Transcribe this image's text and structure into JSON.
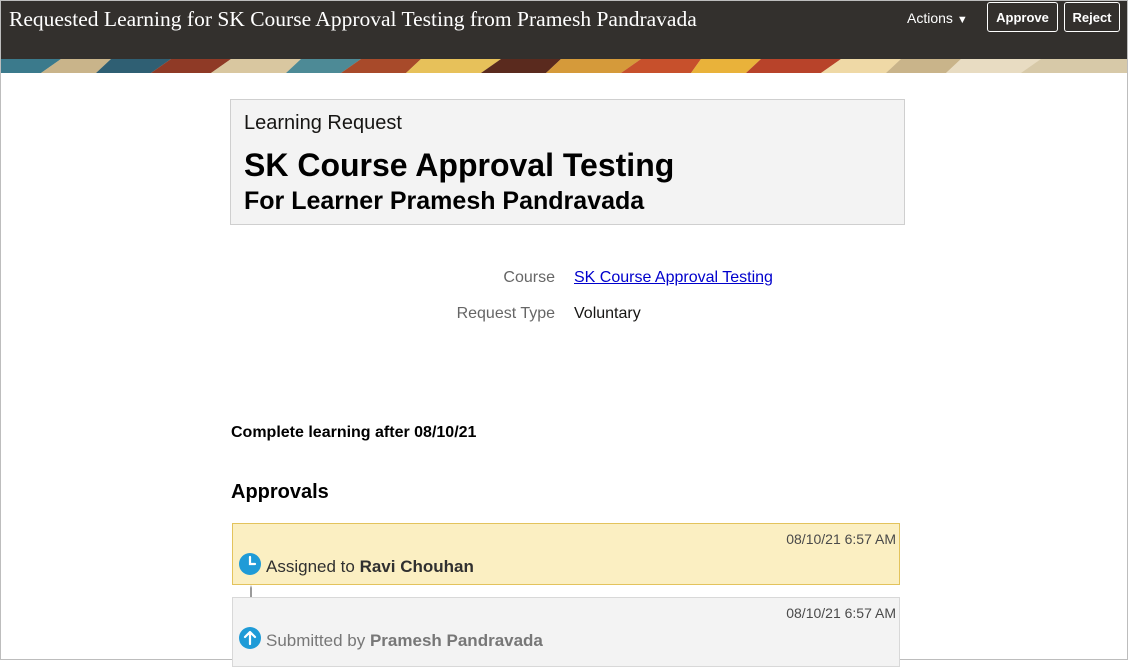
{
  "header": {
    "title": "Requested Learning for SK Course Approval Testing from Pramesh Pandravada",
    "actions_label": "Actions",
    "approve_label": "Approve",
    "reject_label": "Reject",
    "background_color": "#33302d"
  },
  "summary": {
    "subtitle": "Learning Request",
    "course_title": "SK Course Approval Testing",
    "learner_line": "For Learner Pramesh Pandravada"
  },
  "fields": {
    "course_label": "Course",
    "course_value": "SK Course Approval Testing",
    "request_type_label": "Request Type",
    "request_type_value": "Voluntary"
  },
  "complete_note": "Complete learning after 08/10/21",
  "approvals": {
    "heading": "Approvals",
    "items": [
      {
        "timestamp": "08/10/21 6:57 AM",
        "action": "Assigned to",
        "person": "Ravi Chouhan",
        "icon": "clock-icon",
        "status_color": "#fbefc2"
      },
      {
        "timestamp": "08/10/21 6:57 AM",
        "action": "Submitted by",
        "person": "Pramesh Pandravada",
        "icon": "arrow-up-icon",
        "status_color": "#f3f3f3"
      }
    ]
  },
  "colors": {
    "link": "#0000cc",
    "icon": "#1f9bd7"
  }
}
